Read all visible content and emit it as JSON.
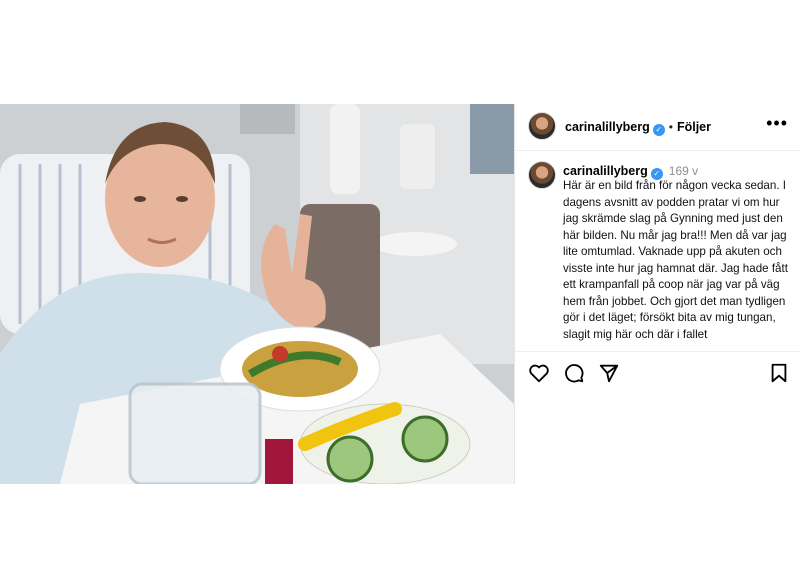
{
  "post": {
    "username": "carinalillyberg",
    "follow_label": "Följer",
    "dot": "•",
    "more_label": "•••"
  },
  "caption": {
    "username": "carinalillyberg",
    "time": "169 v",
    "text": "Här är en bild från för någon vecka sedan. I dagens avsnitt av podden pratar vi om hur jag skrämde slag på Gynning med just den här bilden. Nu mår jag bra!!! Men då var jag lite omtumlad. Vaknade upp på akuten och visste inte hur jag hamnat där. Jag hade fått ett krampanfall på coop när jag var på väg hem från jobbet. Och gjort det man tydligen gör i det läget; försökt bita av mig tungan, slagit mig här och där i fallet"
  },
  "icons": {
    "verified": "verified-badge-icon",
    "heart": "heart-icon",
    "comment": "comment-icon",
    "share": "share-icon",
    "save": "bookmark-icon"
  },
  "colors": {
    "verified": "#3897f0",
    "muted": "#8e8e8e"
  }
}
